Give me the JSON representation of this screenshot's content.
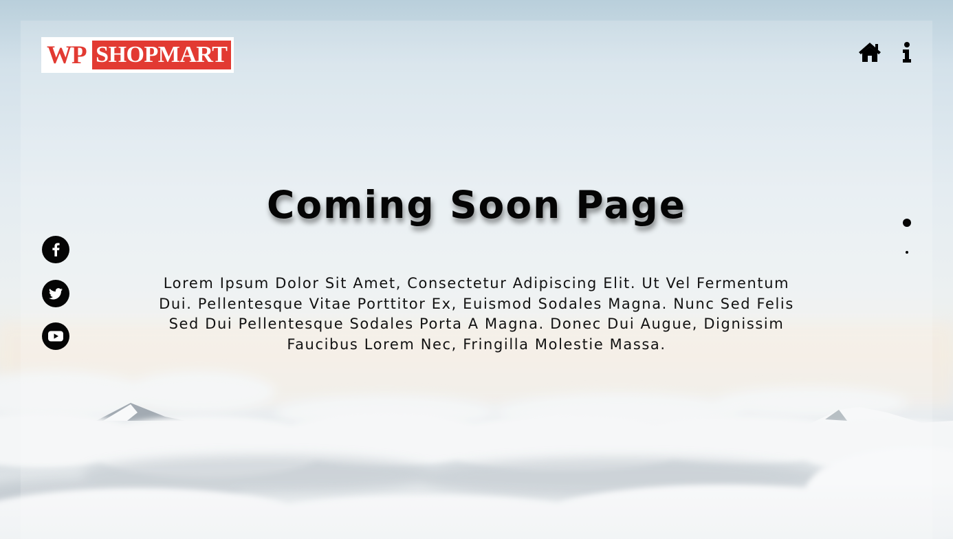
{
  "brand": {
    "logo_prefix": "WP",
    "logo_name": "SHOPMART",
    "accent_color": "#e23a32"
  },
  "nav": {
    "home_icon": "home-icon",
    "info_icon": "info-icon"
  },
  "hero": {
    "title": "Coming Soon Page",
    "description": "Lorem Ipsum Dolor Sit Amet, Consectetur Adipiscing Elit. Ut Vel Fermentum Dui. Pellentesque Vitae Porttitor Ex, Euismod Sodales Magna. Nunc Sed Felis Sed Dui Pellentesque Sodales Porta A Magna. Donec Dui Augue, Dignissim Faucibus Lorem Nec, Fringilla Molestie Massa."
  },
  "social": [
    {
      "icon": "facebook-icon"
    },
    {
      "icon": "twitter-icon"
    },
    {
      "icon": "youtube-icon"
    }
  ],
  "slider": {
    "active_index": 0,
    "count": 2
  }
}
